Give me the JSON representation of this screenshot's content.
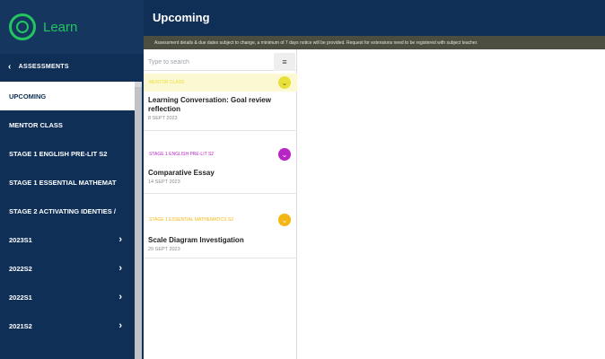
{
  "app": {
    "logo_text": "Learn"
  },
  "header": {
    "title": "Upcoming"
  },
  "notice": "Assessment details & due dates subject to change, a minimum of 7 days notice will be provided. Request for extensions need to be registered with subject teacher.",
  "sidebar": {
    "back_label": "ASSESSMENTS",
    "items": [
      {
        "label": "UPCOMING",
        "active": true
      },
      {
        "label": "MENTOR CLASS"
      },
      {
        "label": "STAGE 1 ENGLISH PRE-LIT S2"
      },
      {
        "label": "STAGE 1 ESSENTIAL MATHEMAT"
      },
      {
        "label": "STAGE 2 ACTIVATING IDENTIES /"
      },
      {
        "label": "2023S1",
        "has_arrow": true
      },
      {
        "label": "2022S2",
        "has_arrow": true
      },
      {
        "label": "2022S1",
        "has_arrow": true
      },
      {
        "label": "2021S2",
        "has_arrow": true
      }
    ]
  },
  "search": {
    "placeholder": "Type to search"
  },
  "groups": [
    {
      "label": "MENTOR CLASS",
      "color": "#e8e03a",
      "bg": "#fbf8d2"
    },
    {
      "label": "STAGE 1 ENGLISH PRE-LIT S2",
      "color": "#b726c4",
      "bg": "#ffffff"
    },
    {
      "label": "STAGE 1 ESSENTIAL MATHEMATICS S2",
      "color": "#f3b612",
      "bg": "#ffffff"
    }
  ],
  "entries": [
    {
      "title": "Learning Conversation: Goal review reflection",
      "date": "8 SEPT 2023"
    },
    {
      "title": "Comparative Essay",
      "date": "14 SEPT 2023"
    },
    {
      "title": "Scale Diagram Investigation",
      "date": "29 SEPT 2023"
    }
  ],
  "colors": {
    "navy": "#0f2f57",
    "logo_green": "#22c55e"
  }
}
